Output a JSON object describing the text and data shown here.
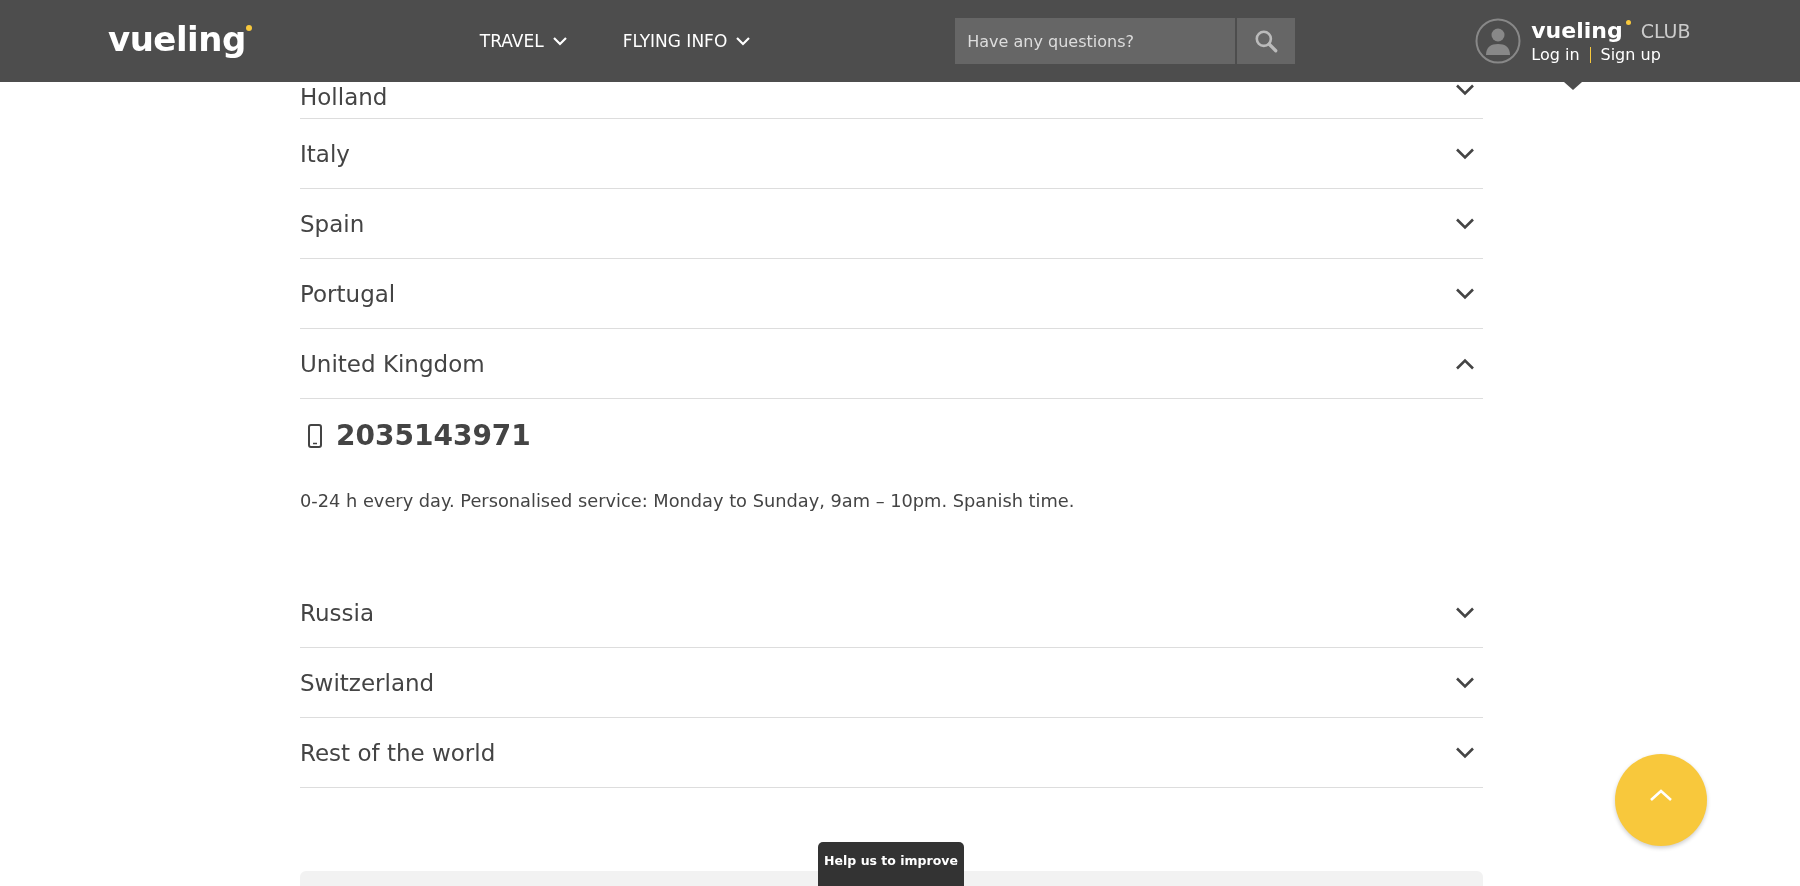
{
  "header": {
    "logo": "vueling",
    "nav": [
      {
        "label": "TRAVEL"
      },
      {
        "label": "FLYING INFO"
      }
    ],
    "search": {
      "placeholder": "Have any questions?"
    },
    "club": {
      "logo": "vueling",
      "label": "CLUB",
      "login": "Log in",
      "signup": "Sign up"
    }
  },
  "countries": [
    {
      "name": "Holland",
      "expanded": false
    },
    {
      "name": "Italy",
      "expanded": false
    },
    {
      "name": "Spain",
      "expanded": false
    },
    {
      "name": "Portugal",
      "expanded": false
    },
    {
      "name": "United Kingdom",
      "expanded": true,
      "phone": "2035143971",
      "hours": "0-24 h every day. Personalised service: Monday to Sunday, 9am – 10pm. Spanish time."
    },
    {
      "name": "Russia",
      "expanded": false
    },
    {
      "name": "Switzerland",
      "expanded": false
    },
    {
      "name": "Rest of the world",
      "expanded": false
    }
  ],
  "feedback_tab": "Help us to improve"
}
